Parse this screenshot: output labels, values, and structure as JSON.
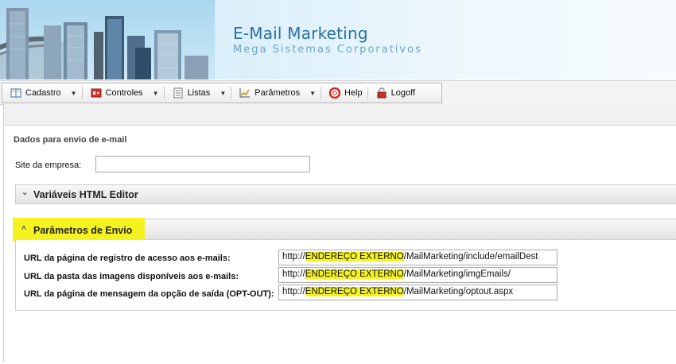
{
  "header": {
    "title": "E-Mail Marketing",
    "subtitle": "Mega Sistemas Corporativos"
  },
  "menu": {
    "items": [
      {
        "label": "Cadastro",
        "icon": "book-icon",
        "dropdown": true
      },
      {
        "label": "Controles",
        "icon": "controls-icon",
        "dropdown": true
      },
      {
        "label": "Listas",
        "icon": "list-icon",
        "dropdown": true
      },
      {
        "label": "Parâmetros",
        "icon": "chart-icon",
        "dropdown": true
      },
      {
        "label": "Help",
        "icon": "lifebuoy-icon",
        "dropdown": false
      },
      {
        "label": "Logoff",
        "icon": "lock-icon",
        "dropdown": false
      }
    ]
  },
  "form": {
    "section_title": "Dados para envio de e-mail",
    "site_label": "Site da empresa:",
    "site_value": "",
    "panel_html_editor": "Variáveis HTML Editor",
    "panel_envio": "Parâmetros de Envio",
    "rows": [
      {
        "label": "URL da página de registro de acesso aos e-mails:",
        "prefix": "http://",
        "highlight": "ENDEREÇO EXTERNO",
        "suffix": "/MailMarketing/include/emailDest"
      },
      {
        "label": "URL da pasta das imagens disponíveis aos e-mails:",
        "prefix": "http://",
        "highlight": "ENDEREÇO EXTERNO",
        "suffix": "/MailMarketing/imgEmails/"
      },
      {
        "label": "URL da página de mensagem da opção de saída (OPT-OUT):",
        "prefix": "http://",
        "highlight": "ENDEREÇO EXTERNO",
        "suffix": "/MailMarketing/optout.aspx"
      }
    ]
  },
  "colors": {
    "highlight": "#f4f21f",
    "title": "#2a6f9e"
  }
}
